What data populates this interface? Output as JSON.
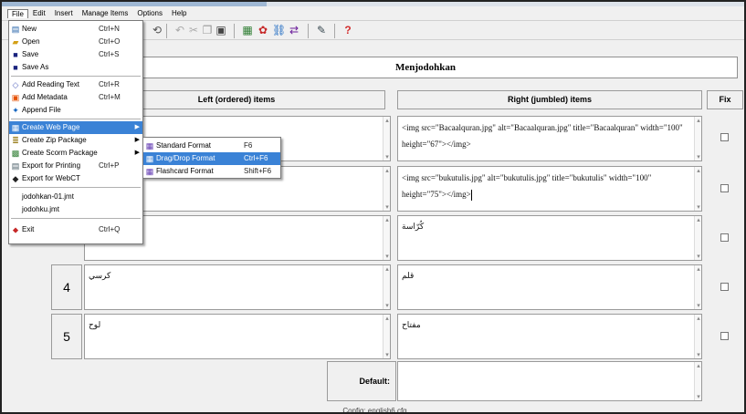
{
  "menubar": {
    "items": [
      "File",
      "Edit",
      "Insert",
      "Manage Items",
      "Options",
      "Help"
    ]
  },
  "title_value": "Menjodohkan",
  "headers": {
    "left": "Left (ordered) items",
    "right": "Right (jumbled) items",
    "fix": "Fix"
  },
  "rows": [
    {
      "number": "",
      "left": "",
      "right": "<img src=\"Bacaalquran.jpg\" alt=\"Bacaalquran.jpg\" title=\"Bacaalquran\" width=\"100\" height=\"67\"></img>"
    },
    {
      "number": "",
      "left": "",
      "right": "<img src=\"bukutulis.jpg\" alt=\"bukutulis.jpg\" title=\"bukutulis\" width=\"100\" height=\"75\"></img>"
    },
    {
      "number": "",
      "left": "",
      "right": "كُرّاسة"
    },
    {
      "number": "4",
      "left": "كرسي",
      "right": "قلم"
    },
    {
      "number": "5",
      "left": "لوح",
      "right": "مفتاح"
    }
  ],
  "default_label": "Default:",
  "default_value": "",
  "status_text": "Config: english6.cfg",
  "file_menu": {
    "items": [
      {
        "label": "New",
        "shortcut": "Ctrl+N",
        "icon": "new-file-icon"
      },
      {
        "label": "Open",
        "shortcut": "Ctrl+O",
        "icon": "open-folder-icon"
      },
      {
        "label": "Save",
        "shortcut": "Ctrl+S",
        "icon": "save-icon"
      },
      {
        "label": "Save As",
        "shortcut": "",
        "icon": "save-as-icon"
      },
      {
        "label": "Add Reading Text",
        "shortcut": "Ctrl+R",
        "icon": "reading-text-icon"
      },
      {
        "label": "Add Metadata",
        "shortcut": "Ctrl+M",
        "icon": "metadata-icon"
      },
      {
        "label": "Append File",
        "shortcut": "",
        "icon": "append-icon"
      },
      {
        "label": "Create Web Page",
        "shortcut": "",
        "icon": "web-page-icon"
      },
      {
        "label": "Create Zip Package",
        "shortcut": "",
        "icon": "zip-icon"
      },
      {
        "label": "Create Scorm Package",
        "shortcut": "",
        "icon": "scorm-icon"
      },
      {
        "label": "Export for Printing",
        "shortcut": "Ctrl+P",
        "icon": "print-icon"
      },
      {
        "label": "Export for WebCT",
        "shortcut": "",
        "icon": "webct-icon"
      },
      {
        "label": "jodohkan-01.jmt",
        "shortcut": "",
        "icon": ""
      },
      {
        "label": "jodohku.jmt",
        "shortcut": "",
        "icon": ""
      },
      {
        "label": "Exit",
        "shortcut": "Ctrl+Q",
        "icon": "exit-icon"
      }
    ]
  },
  "submenu": {
    "items": [
      {
        "label": "Standard Format",
        "shortcut": "F6"
      },
      {
        "label": "Drag/Drop Format",
        "shortcut": "Ctrl+F6"
      },
      {
        "label": "Flashcard Format",
        "shortcut": "Shift+F6"
      }
    ]
  },
  "colors": {
    "highlight": "#3a82d6",
    "background": "#f0f0f0"
  }
}
